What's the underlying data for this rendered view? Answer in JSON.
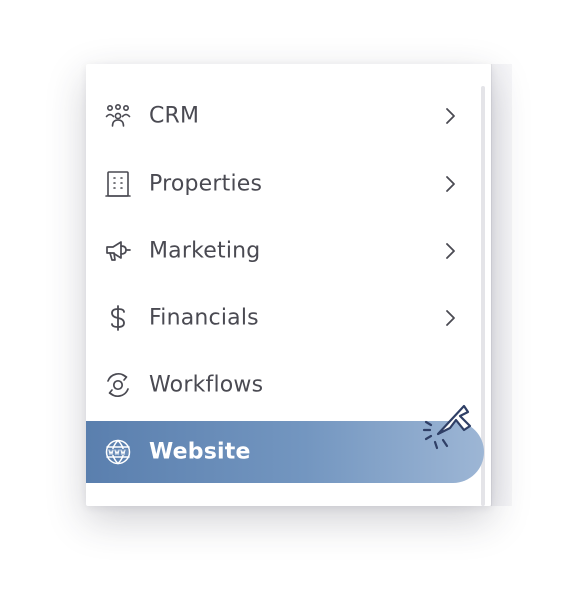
{
  "menu": {
    "items": [
      {
        "label": "CRM",
        "icon": "people-group-icon",
        "has_submenu": true
      },
      {
        "label": "Properties",
        "icon": "building-icon",
        "has_submenu": true
      },
      {
        "label": "Marketing",
        "icon": "megaphone-icon",
        "has_submenu": true
      },
      {
        "label": "Financials",
        "icon": "dollar-icon",
        "has_submenu": true
      },
      {
        "label": "Workflows",
        "icon": "workflow-icon",
        "has_submenu": false
      },
      {
        "label": "Website",
        "icon": "www-globe-icon",
        "has_submenu": false,
        "active": true
      }
    ]
  },
  "colors": {
    "text": "#4a4a52",
    "active_gradient_start": "#5a7fae",
    "active_gradient_end": "#9db6d5",
    "active_text": "#ffffff",
    "cursor_stroke": "#2f3f66"
  }
}
